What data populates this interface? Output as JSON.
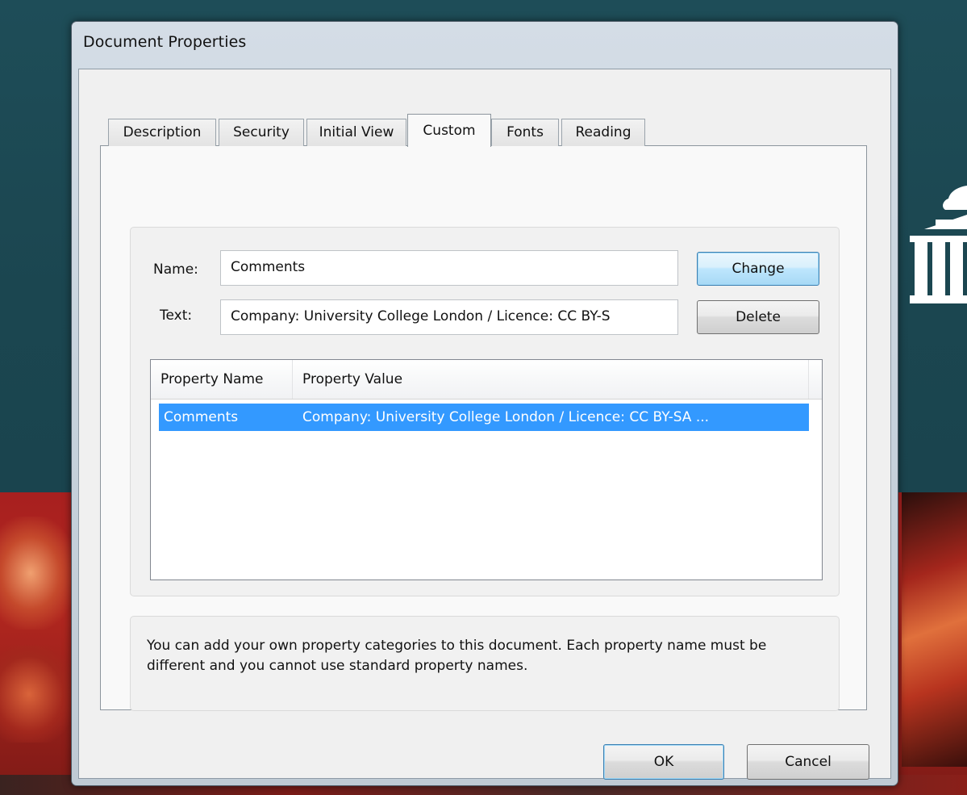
{
  "window": {
    "title": "Document Properties"
  },
  "tabs": [
    {
      "label": "Description"
    },
    {
      "label": "Security"
    },
    {
      "label": "Initial View"
    },
    {
      "label": "Custom",
      "active": true
    },
    {
      "label": "Fonts"
    },
    {
      "label": "Reading"
    }
  ],
  "form": {
    "name_label": "Name:",
    "name_value": "Comments",
    "text_label": "Text:",
    "text_value": "Company: University College London / Licence: CC BY-S",
    "change_label": "Change",
    "delete_label": "Delete"
  },
  "table": {
    "columns": [
      "Property Name",
      "Property Value"
    ],
    "rows": [
      {
        "name": "Comments",
        "value": "Company: University College London / Licence: CC BY-SA ...",
        "selected": true
      }
    ]
  },
  "info_text": "You can add your own property categories to this document. Each property name must be different and you cannot use standard property names.",
  "footer": {
    "ok_label": "OK",
    "cancel_label": "Cancel"
  },
  "colors": {
    "selection": "#3399ff",
    "default_button": "#bee6fd",
    "background_teal": "#1d4a55",
    "background_red": "#a8201f"
  }
}
